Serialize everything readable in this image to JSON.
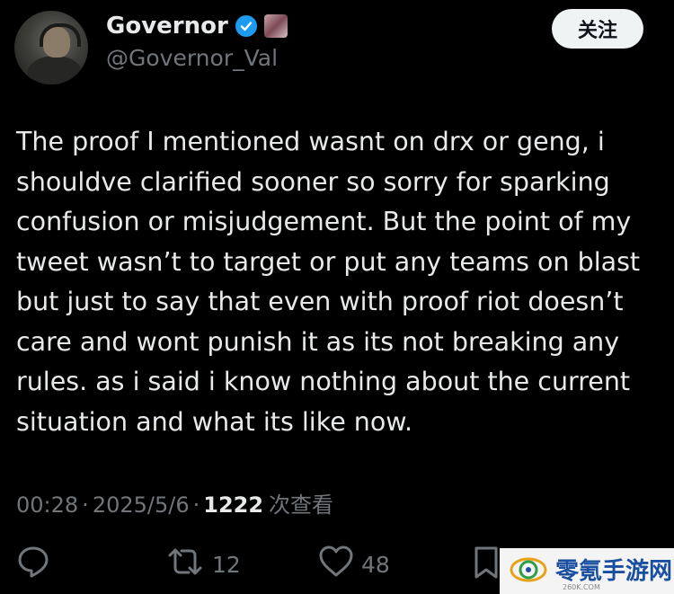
{
  "author": {
    "display_name": "Governor",
    "handle": "@Governor_Val"
  },
  "follow_button": {
    "label": "关注"
  },
  "tweet": {
    "text": "The proof I mentioned wasnt on drx or geng, i\nshouldve clarified sooner so sorry for sparking\nconfusion or misjudgement. But the point of my\ntweet wasn’t to target or put any teams on blast\nbut just to say that even with proof riot doesn’t\ncare and wont punish it as its not breaking any\nrules. as i said i know nothing about the current\nsituation and what its like now."
  },
  "meta": {
    "time": "00:28",
    "separator": "·",
    "date": "2025/5/6",
    "views_count": "1222",
    "views_label": "次查看"
  },
  "actions": {
    "reply_count": "",
    "retweet_count": "12",
    "like_count": "48"
  },
  "watermark": {
    "text": "零氪手游网",
    "sub": "260K.COM"
  },
  "colors": {
    "background": "#000000",
    "text": "#e7e9ea",
    "secondary": "#71767b",
    "verified": "#1d9bf0",
    "follow_bg": "#eff3f4"
  },
  "icons": [
    "verified-icon",
    "reply-icon",
    "retweet-icon",
    "like-icon",
    "bookmark-icon"
  ]
}
